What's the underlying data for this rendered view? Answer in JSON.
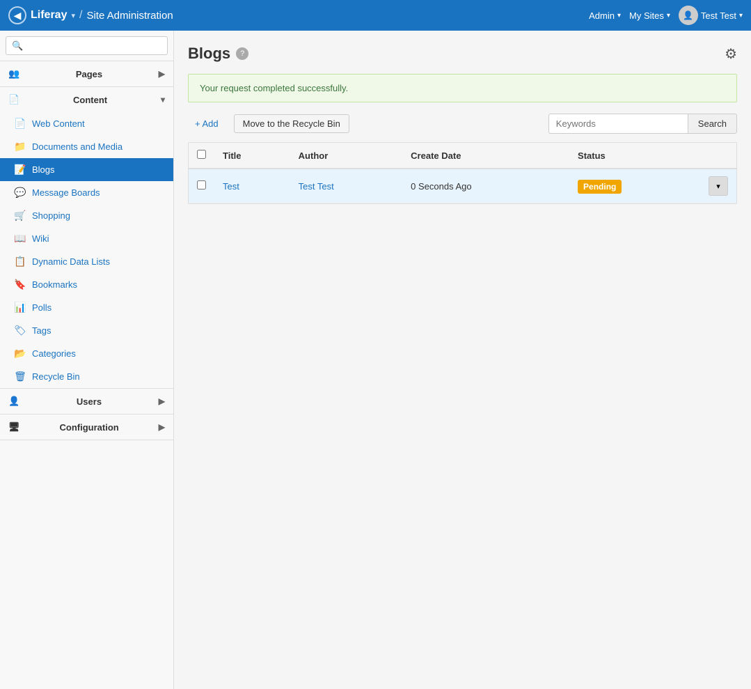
{
  "navbar": {
    "back_icon": "◀",
    "brand": "Liferay",
    "brand_dropdown": "▾",
    "separator": "/",
    "title": "Site Administration",
    "admin_label": "Admin",
    "admin_caret": "▾",
    "my_sites_label": "My Sites",
    "my_sites_caret": "▾",
    "user_label": "Test Test",
    "user_caret": "▾"
  },
  "sidebar": {
    "search_placeholder": "🔍",
    "pages": {
      "label": "Pages",
      "arrow": "▶"
    },
    "content": {
      "label": "Content",
      "arrow": "▾"
    },
    "items": [
      {
        "id": "web-content",
        "icon": "📄",
        "label": "Web Content"
      },
      {
        "id": "documents-and-media",
        "icon": "📁",
        "label": "Documents and Media"
      },
      {
        "id": "blogs",
        "icon": "📝",
        "label": "Blogs",
        "active": true
      },
      {
        "id": "message-boards",
        "icon": "💬",
        "label": "Message Boards"
      },
      {
        "id": "shopping",
        "icon": "🛒",
        "label": "Shopping"
      },
      {
        "id": "wiki",
        "icon": "📖",
        "label": "Wiki"
      },
      {
        "id": "dynamic-data-lists",
        "icon": "📋",
        "label": "Dynamic Data Lists"
      },
      {
        "id": "bookmarks",
        "icon": "🔖",
        "label": "Bookmarks"
      },
      {
        "id": "polls",
        "icon": "📊",
        "label": "Polls"
      },
      {
        "id": "tags",
        "icon": "🏷",
        "label": "Tags"
      },
      {
        "id": "categories",
        "icon": "📂",
        "label": "Categories"
      },
      {
        "id": "recycle-bin",
        "icon": "🗑",
        "label": "Recycle Bin"
      }
    ],
    "users": {
      "label": "Users",
      "arrow": "▶"
    },
    "configuration": {
      "label": "Configuration",
      "arrow": "▶"
    }
  },
  "main": {
    "page_title": "Blogs",
    "help_icon": "?",
    "gear_icon": "⚙",
    "alert": "Your request completed successfully.",
    "add_label": "+ Add",
    "search_placeholder": "Keywords",
    "search_button": "Search",
    "recycle_button": "Move to the Recycle Bin",
    "table": {
      "columns": [
        {
          "id": "checkbox",
          "label": ""
        },
        {
          "id": "title",
          "label": "Title"
        },
        {
          "id": "author",
          "label": "Author"
        },
        {
          "id": "create_date",
          "label": "Create Date"
        },
        {
          "id": "status",
          "label": "Status"
        },
        {
          "id": "actions",
          "label": ""
        }
      ],
      "rows": [
        {
          "title": "Test",
          "author": "Test Test",
          "create_date": "0 Seconds Ago",
          "status": "Pending"
        }
      ]
    }
  }
}
